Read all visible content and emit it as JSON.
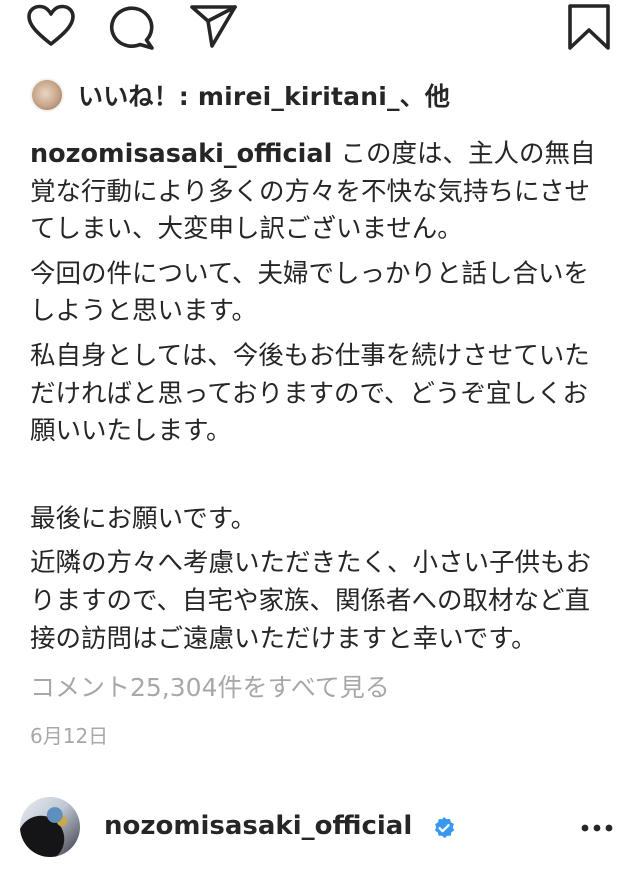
{
  "likes": {
    "label": "いいね！: ",
    "user": "mirei_kiritani_",
    "suffix": "、他"
  },
  "caption": {
    "username": "nozomisasaki_official",
    "paragraphs": [
      "この度は、主人の無自覚な行動により多くの方々を不快な気持ちにさせてしまい、大変申し訳ございません。",
      "今回の件について、夫婦でしっかりと話し合いをしようと思います。",
      "私自身としては、今後もお仕事を続けさせていただければと思っておりますので、どうぞ宜しくお願いいたします。",
      "最後にお願いです。",
      "近隣の方々へ考慮いただきたく、小さい子供もおりますので、自宅や家族、関係者への取材など直接の訪問はご遠慮いただけますと幸いです。"
    ]
  },
  "comments": {
    "view_all": "コメント25,304件をすべて見る"
  },
  "date": "6月12日",
  "author": {
    "username": "nozomisasaki_official",
    "verified": true
  },
  "icons": {
    "like": "heart-icon",
    "comment": "comment-bubble-icon",
    "share": "paper-plane-icon",
    "save": "bookmark-icon",
    "verified": "verified-badge-icon",
    "more": "more-options-icon"
  },
  "colors": {
    "text": "#262626",
    "muted": "#a8a8a8",
    "verified": "#3897f0"
  }
}
